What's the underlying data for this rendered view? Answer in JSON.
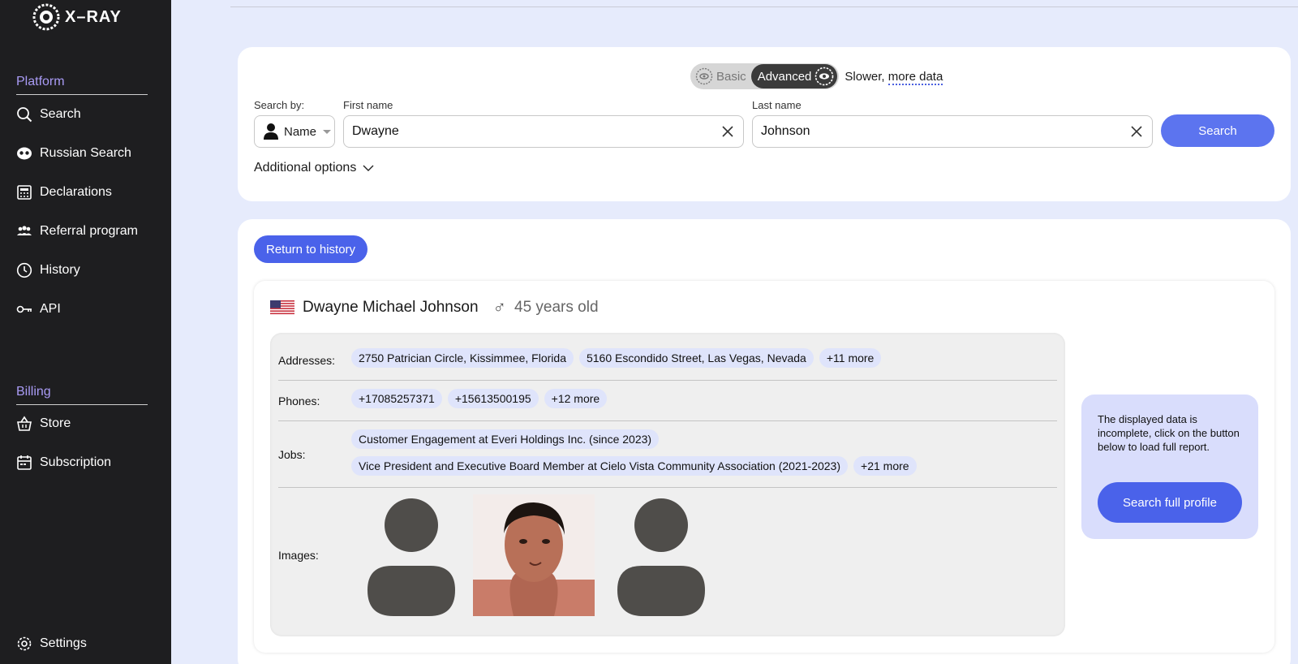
{
  "app": {
    "logo_text": "X–RAY"
  },
  "sidebar": {
    "platform_title": "Platform",
    "platform_items": [
      {
        "label": "Search",
        "icon": "search-icon"
      },
      {
        "label": "Russian Search",
        "icon": "mask-icon"
      },
      {
        "label": "Declarations",
        "icon": "calculator-icon"
      },
      {
        "label": "Referral program",
        "icon": "users-icon"
      },
      {
        "label": "History",
        "icon": "clock-icon"
      },
      {
        "label": "API",
        "icon": "key-icon"
      }
    ],
    "billing_title": "Billing",
    "billing_items": [
      {
        "label": "Store",
        "icon": "basket-icon"
      },
      {
        "label": "Subscription",
        "icon": "calendar-icon"
      }
    ],
    "settings_label": "Settings"
  },
  "search": {
    "mode_basic": "Basic",
    "mode_advanced": "Advanced",
    "mode_note_prefix": "Slower, ",
    "mode_note_link": "more data",
    "search_by_label": "Search by:",
    "search_by_value": "Name",
    "first_name_label": "First name",
    "first_name_value": "Dwayne",
    "last_name_label": "Last name",
    "last_name_value": "Johnson",
    "search_button": "Search",
    "additional_options": "Additional options"
  },
  "results": {
    "return_button": "Return to history",
    "profile": {
      "name": "Dwayne Michael Johnson",
      "gender_symbol": "♂",
      "age": "45 years old",
      "addresses_label": "Addresses:",
      "addresses": [
        "2750 Patrician Circle, Kissimmee, Florida",
        "5160 Escondido Street, Las Vegas, Nevada"
      ],
      "addresses_more": "+11 more",
      "phones_label": "Phones:",
      "phones": [
        "+17085257371",
        "+15613500195"
      ],
      "phones_more": "+12 more",
      "jobs_label": "Jobs:",
      "jobs": [
        "Customer Engagement at Everi Holdings Inc. (since 2023)",
        "Vice President and Executive Board Member at Cielo Vista Community Association (2021-2023)"
      ],
      "jobs_more": "+21 more",
      "images_label": "Images:"
    },
    "notice_text": "The displayed data is incomplete, click on the button below to load full report.",
    "full_profile_button": "Search full profile"
  },
  "colors": {
    "accent": "#4a62ea",
    "sidebar_bg": "#1e1e20",
    "section_title": "#a99bf5",
    "page_bg": "#e6ebfc",
    "chip_bg": "#dfe4fb"
  }
}
